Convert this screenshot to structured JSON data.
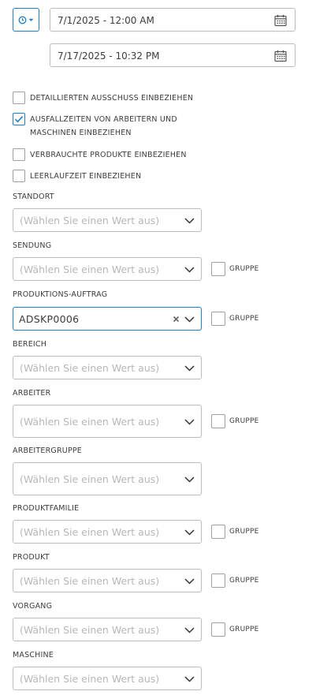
{
  "date_range": {
    "start": "7/1/2025 - 12:00 AM",
    "end": "7/17/2025 - 10:32 PM"
  },
  "options": [
    {
      "label": "DETAILLIERTEN AUSSCHUSS EINBEZIEHEN",
      "checked": false
    },
    {
      "label": "AUSFALLZEITEN VON ARBEITERN UND",
      "label2": "MASCHINEN EINBEZIEHEN",
      "checked": true
    },
    {
      "label": "VERBRAUCHTE PRODUKTE EINBEZIEHEN",
      "checked": false
    },
    {
      "label": "LEERLAUFZEIT EINBEZIEHEN",
      "checked": false
    }
  ],
  "placeholder": "(Wählen Sie einen Wert aus)",
  "group_label": "GRUPPE",
  "filters": {
    "standort": {
      "label": "STANDORT"
    },
    "sendung": {
      "label": "SENDUNG"
    },
    "produktionsauftrag": {
      "label": "PRODUKTIONS-AUFTRAG",
      "value": "ADSKP0006"
    },
    "bereich": {
      "label": "BEREICH"
    },
    "arbeiter": {
      "label": "ARBEITER"
    },
    "arbeitergruppe": {
      "label": "ARBEITERGRUPPE"
    },
    "produktfamilie": {
      "label": "PRODUKTFAMILIE"
    },
    "produkt": {
      "label": "PRODUKT"
    },
    "vorgang": {
      "label": "VORGANG"
    },
    "maschine": {
      "label": "MASCHINE"
    }
  },
  "colors": {
    "accent": "#1f7fc9",
    "border": "#bdbdbd",
    "placeholder": "#b7b7b7"
  }
}
